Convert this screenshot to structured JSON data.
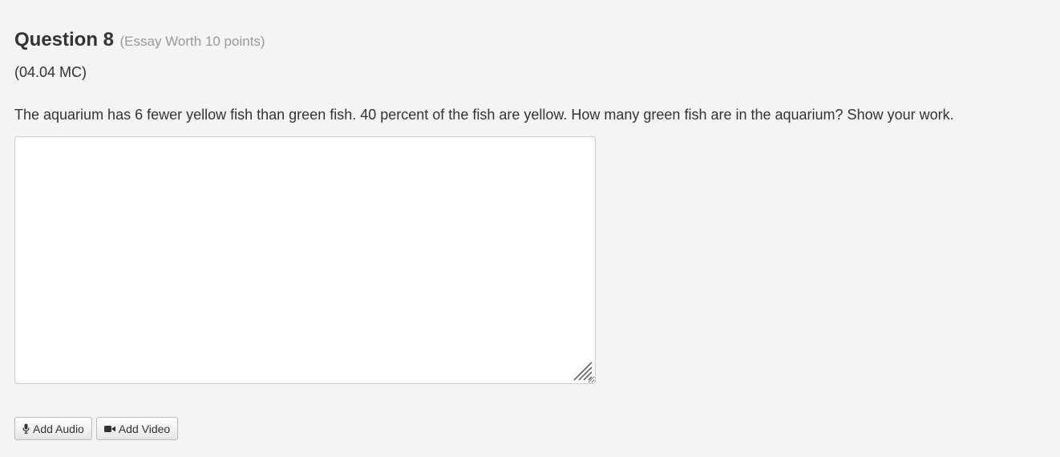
{
  "question": {
    "title": "Question 8",
    "meta": "(Essay Worth 10 points)",
    "code": "(04.04 MC)",
    "prompt": "The aquarium has 6 fewer yellow fish than green fish. 40 percent of the fish are yellow. How many green fish are in the aquarium? Show your work."
  },
  "answer": {
    "value": "",
    "placeholder": ""
  },
  "media": {
    "audio_label": "Add Audio",
    "video_label": "Add Video",
    "audio_icon": "microphone-icon",
    "video_icon": "video-camera-icon"
  },
  "colors": {
    "background": "#f4f4f4",
    "text": "#333333",
    "meta_text": "#999999",
    "border": "#cccccc"
  }
}
